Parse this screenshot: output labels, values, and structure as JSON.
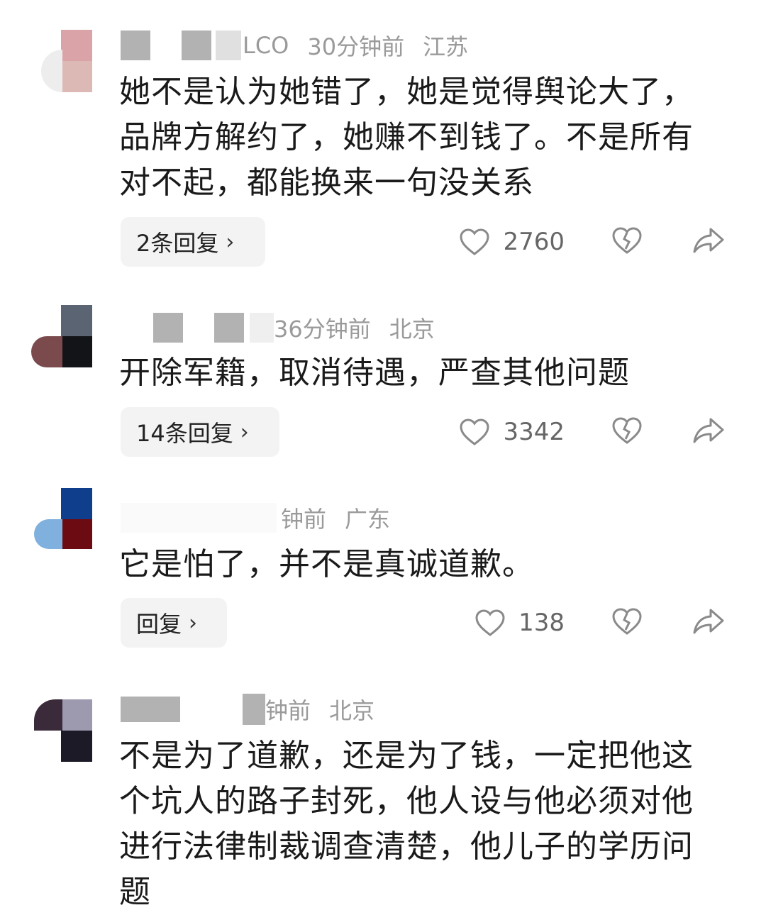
{
  "comments": [
    {
      "meta_name": "LCO",
      "meta_time": "30分钟前",
      "meta_loc": "江苏",
      "text": "她不是认为她错了，她是觉得舆论大了，品牌方解约了，她赚不到钱了。不是所有对不起，都能换来一句没关系",
      "reply_label": "2条回复",
      "likes": "2760"
    },
    {
      "meta_time": "36分钟前",
      "meta_loc": "北京",
      "text": "开除军籍，取消待遇，严查其他问题",
      "reply_label": "14条回复",
      "likes": "3342"
    },
    {
      "meta_time": "钟前",
      "meta_loc": "广东",
      "text": "它是怕了，并不是真诚道歉。",
      "reply_label": "回复",
      "likes": "138"
    },
    {
      "meta_time": "钟前",
      "meta_loc": "北京",
      "text": "不是为了道歉，还是为了钱，一定把他这个坑人的路子封死，他人设与他必须对他进行法律制裁调查清楚，他儿子的学历问题"
    }
  ],
  "icons": {
    "like": "heart-outline-icon",
    "dislike": "broken-heart-icon",
    "share": "share-arrow-icon",
    "chevron": "chevron-right-icon"
  },
  "colors": {
    "text": "#1a1a1a",
    "meta": "#9a9a9a",
    "reply_bg": "#f3f3f3",
    "icon": "#8a8a8a"
  }
}
